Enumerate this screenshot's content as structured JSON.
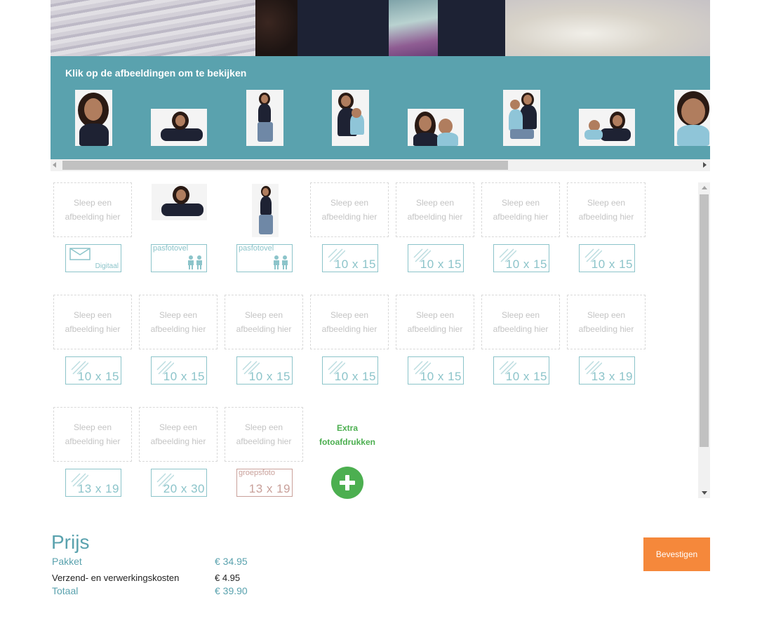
{
  "band": {
    "title": "Klik op de afbeeldingen om te bekijken"
  },
  "drop_text": {
    "line1": "Sleep een",
    "line2": "afbeelding hier"
  },
  "slots_row1": [
    {
      "label": "Digitaal",
      "format": "digital"
    },
    {
      "label": "pasfotovel",
      "format": "pasfoto"
    },
    {
      "label": "pasfotovel",
      "format": "pasfoto"
    },
    {
      "label": "10 x 15",
      "format": "print"
    },
    {
      "label": "10 x 15",
      "format": "print"
    },
    {
      "label": "10 x 15",
      "format": "print"
    },
    {
      "label": "10 x 15",
      "format": "print"
    }
  ],
  "slots_row2": [
    {
      "label": "10 x 15"
    },
    {
      "label": "10 x 15"
    },
    {
      "label": "10 x 15"
    },
    {
      "label": "10 x 15"
    },
    {
      "label": "10 x 15"
    },
    {
      "label": "10 x 15"
    },
    {
      "label": "13 x 19"
    }
  ],
  "slots_row3": [
    {
      "label": "13 x 19"
    },
    {
      "label": "20 x 30"
    },
    {
      "label": "groepsfoto",
      "size": "13 x 19"
    }
  ],
  "extra": {
    "line1": "Extra",
    "line2": "fotoafdrukken"
  },
  "price": {
    "title": "Prijs",
    "pakket_label": "Pakket",
    "pakket_value": "€ 34.95",
    "verzend_label": "Verzend- en verwerkingskosten",
    "verzend_value": "€ 4.95",
    "totaal_label": "Totaal",
    "totaal_value": "€ 39.90"
  },
  "confirm_label": "Bevestigen",
  "colors": {
    "teal": "#5aa2ae",
    "orange": "#f5883b",
    "green": "#4caf50",
    "format_border": "#8cc4ca",
    "group_border": "#c9a09a"
  }
}
